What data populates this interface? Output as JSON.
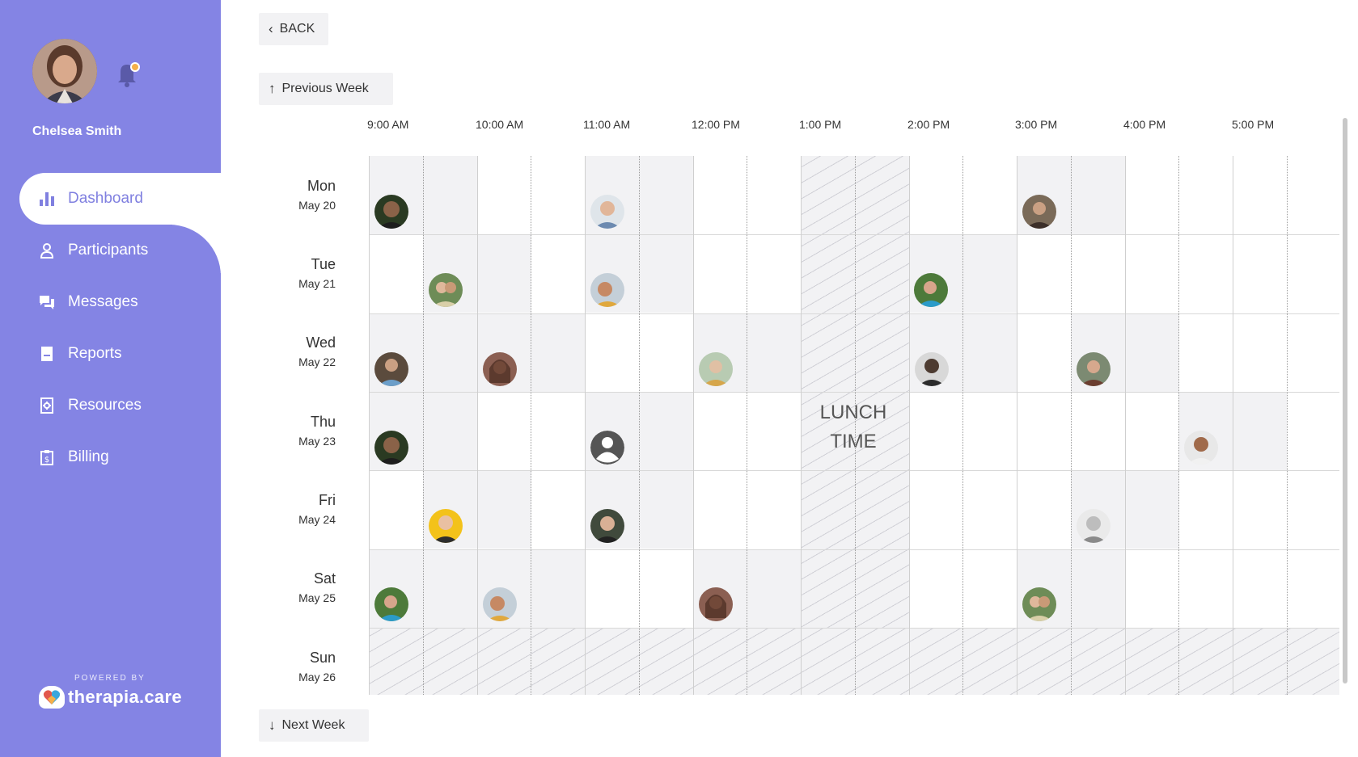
{
  "user": {
    "name": "Chelsea Smith",
    "notification_dot_color": "#f4b04a"
  },
  "nav": {
    "active": "Dashboard",
    "items": [
      {
        "label": "Dashboard",
        "icon": "bar-chart-icon"
      },
      {
        "label": "Participants",
        "icon": "person-icon"
      },
      {
        "label": "Messages",
        "icon": "chat-icon"
      },
      {
        "label": "Reports",
        "icon": "document-icon"
      },
      {
        "label": "Resources",
        "icon": "gear-doc-icon"
      },
      {
        "label": "Billing",
        "icon": "clipboard-dollar-icon"
      }
    ]
  },
  "brand": {
    "powered_by": "POWERED BY",
    "name": "therapia.care"
  },
  "toolbar": {
    "back_label": "BACK",
    "prev_week_label": "Previous Week",
    "next_week_label": "Next Week"
  },
  "calendar": {
    "times": [
      "9:00 AM",
      "10:00 AM",
      "11:00 AM",
      "12:00 PM",
      "1:00 PM",
      "2:00 PM",
      "3:00 PM",
      "4:00 PM",
      "5:00 PM"
    ],
    "days": [
      {
        "name": "Mon",
        "date": "May 20"
      },
      {
        "name": "Tue",
        "date": "May 21"
      },
      {
        "name": "Wed",
        "date": "May 22"
      },
      {
        "name": "Thu",
        "date": "May 23"
      },
      {
        "name": "Fri",
        "date": "May 24"
      },
      {
        "name": "Sat",
        "date": "May 25"
      },
      {
        "name": "Sun",
        "date": "May 26"
      }
    ],
    "lunch_label_line1": "LUNCH",
    "lunch_label_line2": "TIME",
    "colors": {
      "accent": "#8484e4",
      "shade": "#f2f2f4",
      "lunch_hatch": "#d0d0d6"
    }
  }
}
